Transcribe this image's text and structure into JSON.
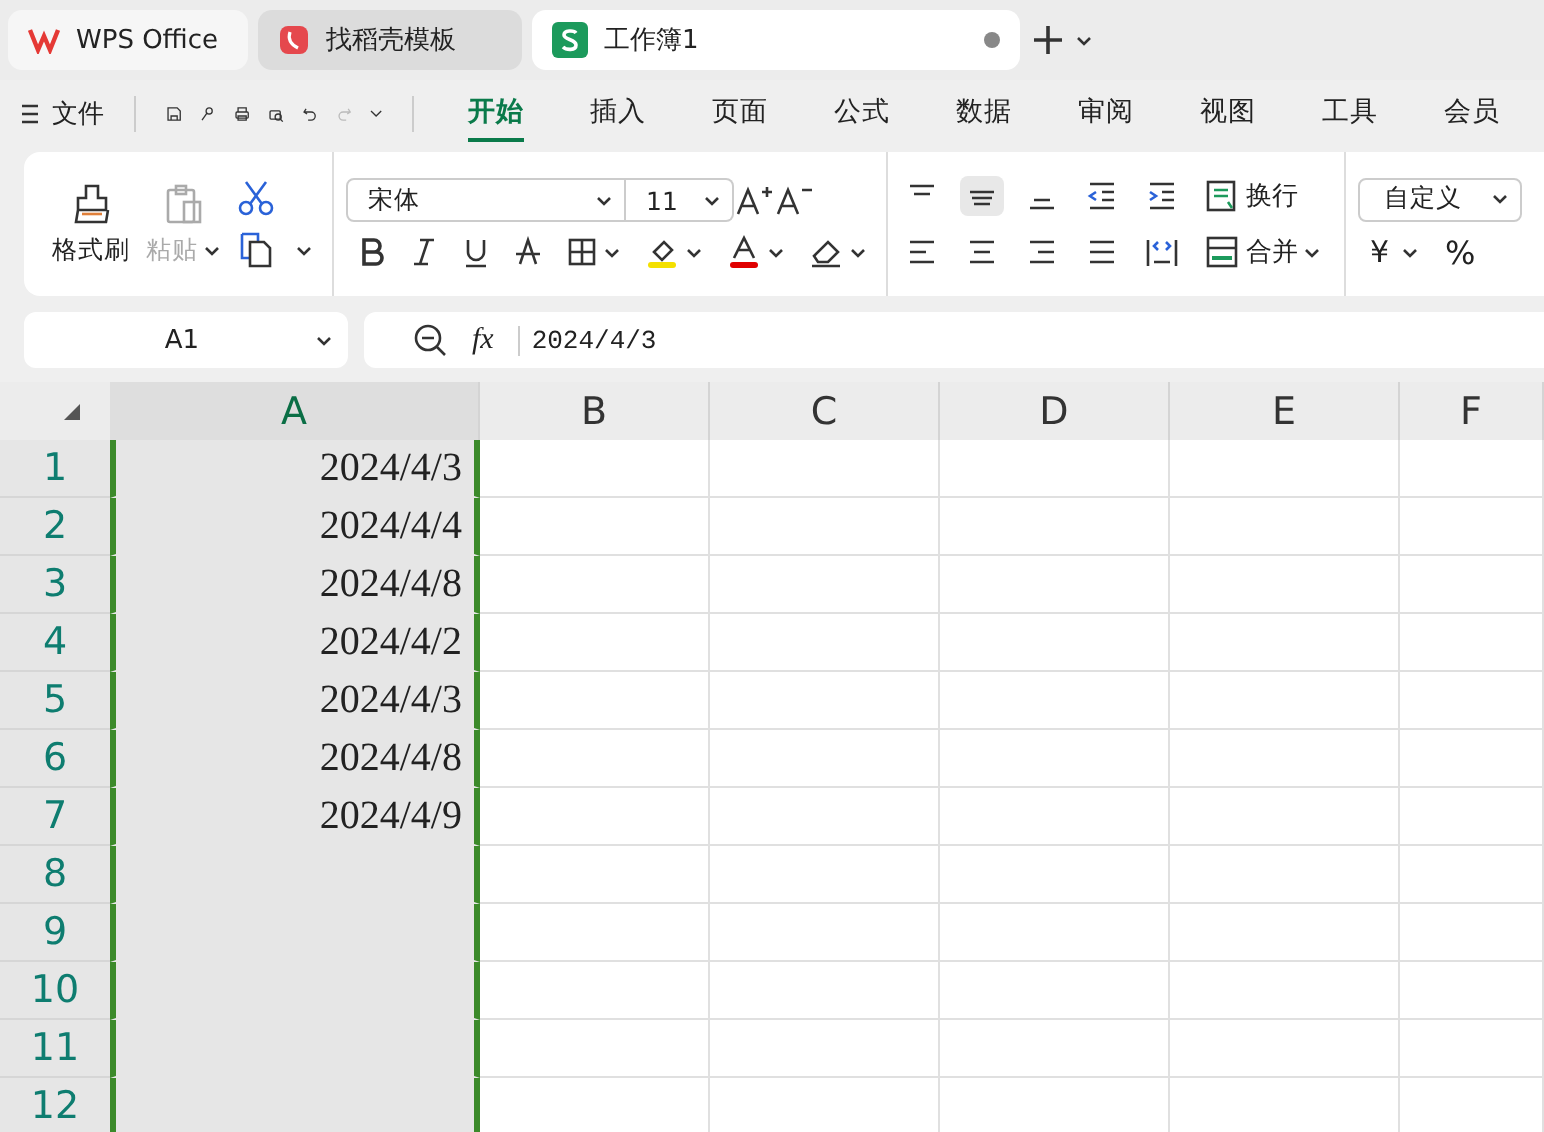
{
  "tabs": [
    {
      "label": "WPS Office",
      "kind": "wps",
      "selected": false
    },
    {
      "label": "找稻壳模板",
      "kind": "template",
      "selected": false
    },
    {
      "label": "工作簿1",
      "kind": "sheet",
      "selected": true
    }
  ],
  "menu": {
    "file": "文件",
    "ribbon_tabs": [
      {
        "label": "开始",
        "selected": true
      },
      {
        "label": "插入",
        "selected": false
      },
      {
        "label": "页面",
        "selected": false
      },
      {
        "label": "公式",
        "selected": false
      },
      {
        "label": "数据",
        "selected": false
      },
      {
        "label": "审阅",
        "selected": false
      },
      {
        "label": "视图",
        "selected": false
      },
      {
        "label": "工具",
        "selected": false
      },
      {
        "label": "会员",
        "selected": false
      }
    ]
  },
  "ribbon": {
    "format_painter": {
      "label": "格式刷",
      "disabled": false
    },
    "paste": {
      "label": "粘贴",
      "disabled": true
    },
    "font_name": "宋体",
    "font_size": "11",
    "wrap": "换行",
    "merge": "合并",
    "number_format": "自定义",
    "currency": "¥",
    "percent": "%"
  },
  "formula_bar": {
    "name_box": "A1",
    "function_label": "fx",
    "formula": "2024/4/3"
  },
  "sheet": {
    "columns": [
      {
        "label": "A",
        "selected": true
      },
      {
        "label": "B",
        "selected": false
      },
      {
        "label": "C",
        "selected": false
      },
      {
        "label": "D",
        "selected": false
      },
      {
        "label": "E",
        "selected": false
      },
      {
        "label": "F",
        "selected": false
      }
    ],
    "rows": [
      {
        "label": "1",
        "selected": true,
        "cells": [
          "2024/4/3"
        ]
      },
      {
        "label": "2",
        "selected": true,
        "cells": [
          "2024/4/4"
        ]
      },
      {
        "label": "3",
        "selected": true,
        "cells": [
          "2024/4/8"
        ]
      },
      {
        "label": "4",
        "selected": true,
        "cells": [
          "2024/4/2"
        ]
      },
      {
        "label": "5",
        "selected": true,
        "cells": [
          "2024/4/3"
        ]
      },
      {
        "label": "6",
        "selected": true,
        "cells": [
          "2024/4/8"
        ]
      },
      {
        "label": "7",
        "selected": true,
        "cells": [
          "2024/4/9"
        ]
      },
      {
        "label": "8",
        "selected": true,
        "cells": []
      },
      {
        "label": "9",
        "selected": true,
        "cells": []
      },
      {
        "label": "10",
        "selected": true,
        "cells": []
      },
      {
        "label": "11",
        "selected": true,
        "cells": []
      },
      {
        "label": "12",
        "selected": true,
        "cells": []
      }
    ]
  }
}
